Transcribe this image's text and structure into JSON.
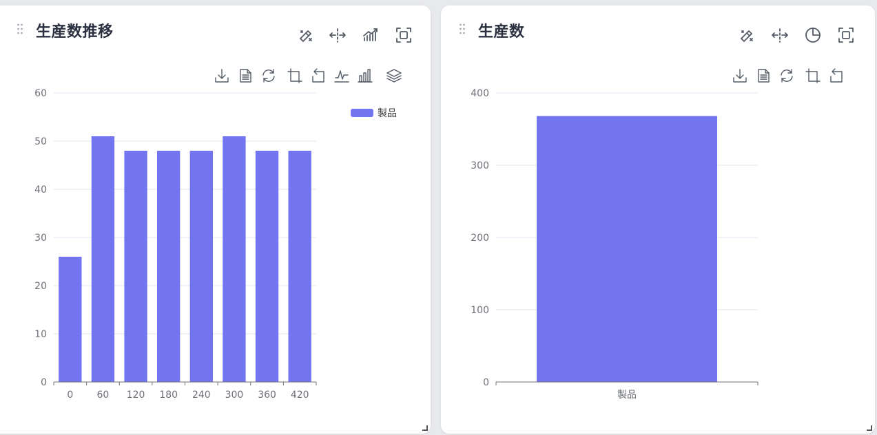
{
  "colors": {
    "bar": "#7375f0",
    "grid": "#e0e6f1",
    "axis": "#6e7079",
    "icon": "#545b66",
    "title": "#2b3140",
    "panel_bg": "#ffffff",
    "page_bg": "#e8e9ed"
  },
  "panels": [
    {
      "title": "生産数推移",
      "header_icons": [
        "magic-wand-icon",
        "split-arrows-icon",
        "trend-chart-icon",
        "fullscreen-icon"
      ],
      "toolbox_icons": [
        "download-icon",
        "data-view-icon",
        "restore-icon",
        "zoom-icon",
        "zoom-back-icon",
        "line-chart-icon",
        "bar-chart-icon",
        "stack-icon"
      ]
    },
    {
      "title": "生産数",
      "header_icons": [
        "magic-wand-icon",
        "split-arrows-icon",
        "pie-chart-icon",
        "fullscreen-icon"
      ],
      "toolbox_icons": [
        "download-icon",
        "data-view-icon",
        "restore-icon",
        "zoom-icon",
        "zoom-back-icon"
      ]
    }
  ],
  "chart_data": [
    {
      "type": "bar",
      "categories": [
        "0",
        "60",
        "120",
        "180",
        "240",
        "300",
        "360",
        "420"
      ],
      "series": [
        {
          "name": "製品",
          "values": [
            26,
            51,
            48,
            48,
            48,
            51,
            48,
            48
          ]
        }
      ],
      "yticks": [
        "0",
        "10",
        "20",
        "30",
        "40",
        "50",
        "60"
      ],
      "ylim": [
        0,
        60
      ],
      "grid": true,
      "legend": "top-right"
    },
    {
      "type": "bar",
      "categories": [
        "製品"
      ],
      "series": [
        {
          "values": [
            368
          ]
        }
      ],
      "yticks": [
        "0",
        "100",
        "200",
        "300",
        "400"
      ],
      "ylim": [
        0,
        400
      ],
      "grid": true
    }
  ]
}
